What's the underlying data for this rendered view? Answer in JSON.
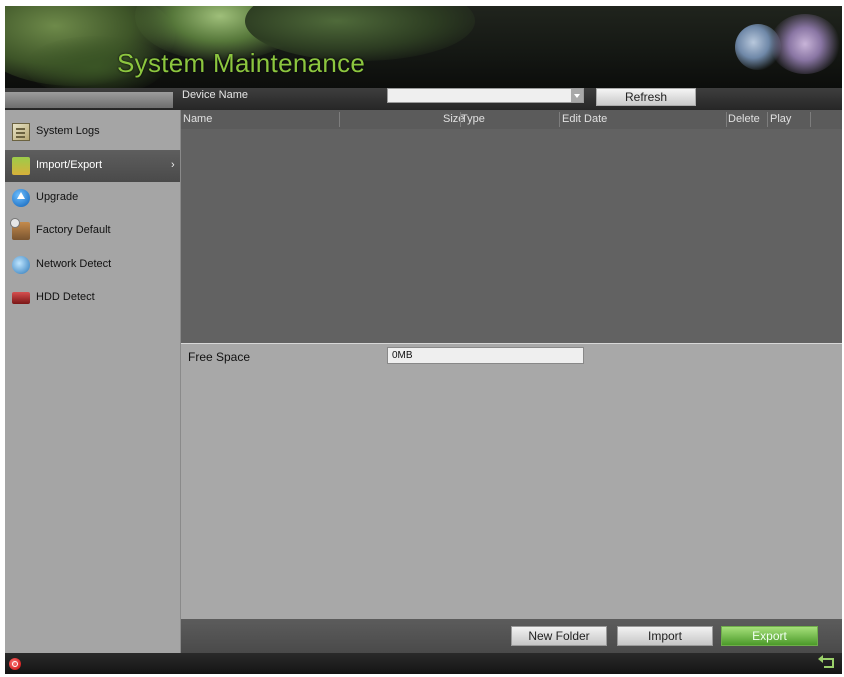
{
  "window": {
    "title": "System Maintenance"
  },
  "toolbar": {
    "device_label": "Device Name",
    "device_value": "",
    "refresh_label": "Refresh"
  },
  "sidebar": {
    "items": [
      {
        "label": "System Logs",
        "icon": "document-icon",
        "active": false
      },
      {
        "label": "Import/Export",
        "icon": "folder-icon",
        "active": true,
        "chevron": "›"
      },
      {
        "label": "Upgrade",
        "icon": "upgrade-arrow-icon",
        "active": false
      },
      {
        "label": "Factory Default",
        "icon": "factory-default-icon",
        "active": false
      },
      {
        "label": "Network Detect",
        "icon": "network-globe-icon",
        "active": false
      },
      {
        "label": "HDD Detect",
        "icon": "hdd-icon",
        "active": false
      }
    ]
  },
  "file_table": {
    "columns": [
      "Name",
      "Size",
      "Type",
      "Edit Date",
      "Delete",
      "Play"
    ],
    "rows": []
  },
  "storage": {
    "free_space_label": "Free Space",
    "free_space_value": "0MB"
  },
  "actions": {
    "new_folder": "New Folder",
    "import": "Import",
    "export": "Export"
  },
  "status": {
    "record_icon": "record-indicator-icon",
    "back_icon": "back-arrow-icon"
  },
  "colors": {
    "title": "#8cc63f",
    "export_button": "#4c9a2a",
    "record_indicator": "#c40000"
  }
}
